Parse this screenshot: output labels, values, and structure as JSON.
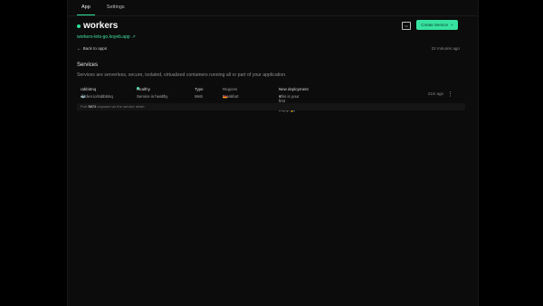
{
  "tabs": [
    {
      "label": "App",
      "active": true
    },
    {
      "label": "Settings",
      "active": false
    }
  ],
  "app": {
    "name": "workers",
    "url": "workers-lets-go.koyeb.app",
    "back_label": "Back to apps",
    "updated": "22 minutes ago",
    "create_service_label": "Create Service",
    "create_service_icon": "plus-icon",
    "accent": "#2fe39b"
  },
  "services_section": {
    "title": "Services",
    "description": "Services are serverless, secure, isolated, virtualized containers running all or part of your application."
  },
  "table": {
    "headers": [
      "rabbitmq",
      "Healthy",
      "Type",
      "Regions",
      "New deployment"
    ],
    "row": {
      "image": "docker.io/rabbitmq",
      "status": "Service is healthy",
      "type": "Web",
      "region": "Frankfurt",
      "message": "This is your first deployment! Enjoy! 🎉",
      "time": "21m ago"
    }
  },
  "status_bar": {
    "prefix": "Port",
    "port": "5672",
    "suffix": "exposed on the service mesh"
  }
}
